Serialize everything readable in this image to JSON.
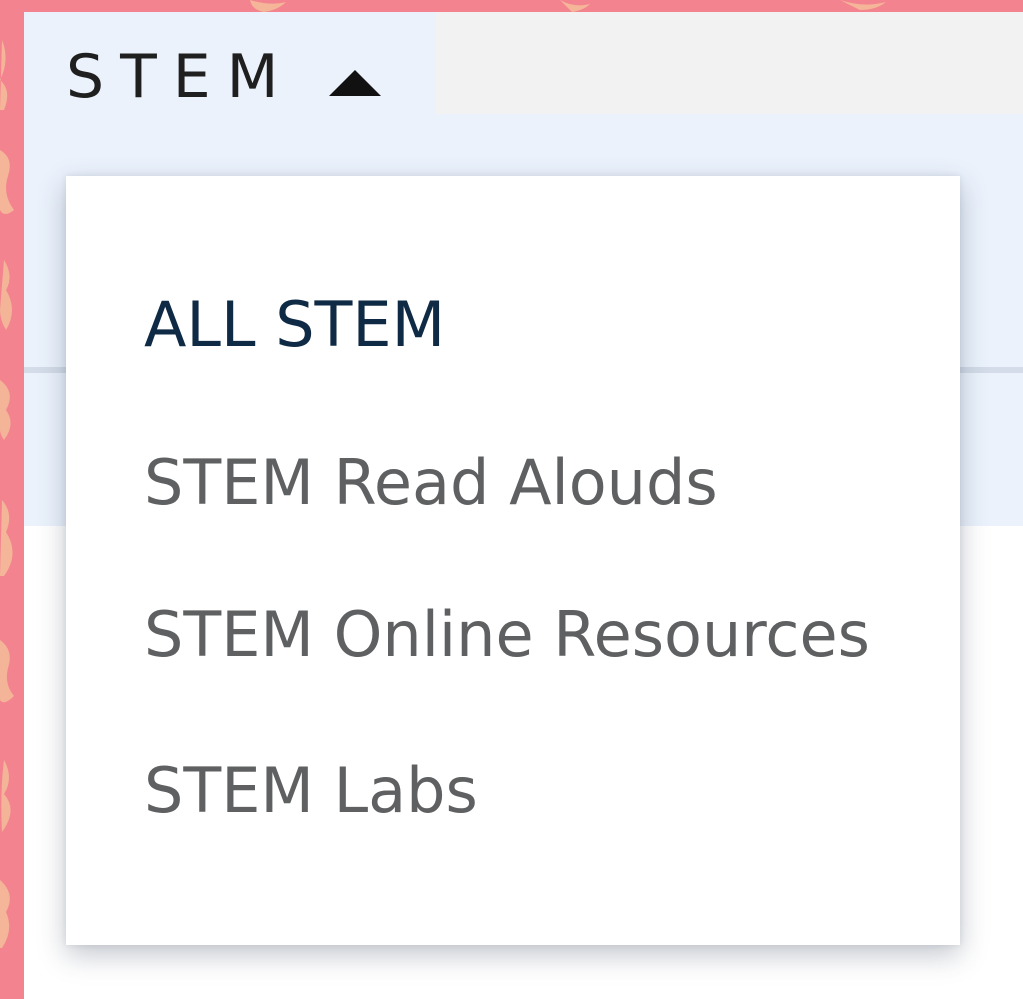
{
  "nav": {
    "toggle_label": "STEM",
    "caret_icon": "caret-up-icon"
  },
  "dropdown": {
    "items": [
      {
        "label": "ALL STEM",
        "active": true
      },
      {
        "label": "STEM Read Alouds",
        "active": false
      },
      {
        "label": "STEM Online Resources",
        "active": false
      },
      {
        "label": "STEM Labs",
        "active": false
      }
    ]
  },
  "colors": {
    "background_accent": "#f3848f",
    "nav_band": "#ebf2fc",
    "active_item": "#0f2a45",
    "inactive_item": "#5f6061"
  }
}
